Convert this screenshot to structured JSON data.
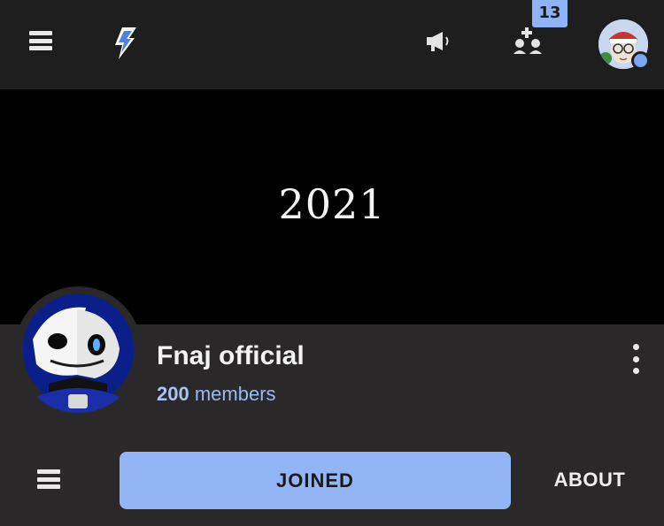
{
  "topbar": {
    "notifications_count": "13",
    "icons": [
      "menu-icon",
      "lightning-logo-icon",
      "megaphone-icon",
      "add-friends-icon",
      "user-avatar"
    ]
  },
  "banner": {
    "text": "2021"
  },
  "community": {
    "name": "Fnaj official",
    "members_count": "200",
    "members_label": "members"
  },
  "actions": {
    "joined_label": "JOINED",
    "about_label": "ABOUT"
  },
  "colors": {
    "topbar_bg": "#1f1e1e",
    "body_bg": "#2a2828",
    "accent": "#93b5f6",
    "members_text": "#9bb9f2"
  }
}
